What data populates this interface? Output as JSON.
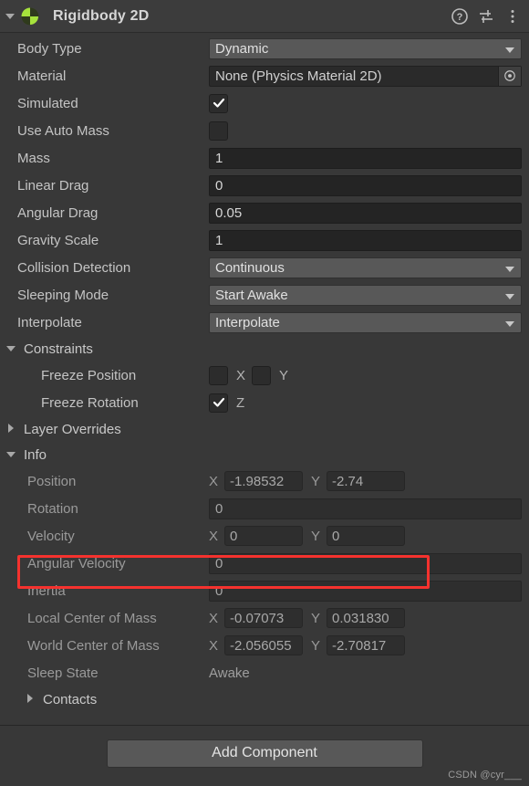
{
  "component": {
    "title": "Rigidbody 2D",
    "icon": "rigidbody2d-icon",
    "expanded": true,
    "header_icons": [
      {
        "name": "help-icon",
        "glyph": "?"
      },
      {
        "name": "preset-icon",
        "glyph": "sliders"
      },
      {
        "name": "more-menu-icon",
        "glyph": "kebab"
      }
    ]
  },
  "properties": {
    "body_type": {
      "label": "Body Type",
      "value": "Dynamic"
    },
    "material": {
      "label": "Material",
      "value": "None (Physics Material 2D)"
    },
    "simulated": {
      "label": "Simulated",
      "checked": true
    },
    "use_auto_mass": {
      "label": "Use Auto Mass",
      "checked": false
    },
    "mass": {
      "label": "Mass",
      "value": "1"
    },
    "linear_drag": {
      "label": "Linear Drag",
      "value": "0"
    },
    "angular_drag": {
      "label": "Angular Drag",
      "value": "0.05"
    },
    "gravity_scale": {
      "label": "Gravity Scale",
      "value": "1"
    },
    "collision_detection": {
      "label": "Collision Detection",
      "value": "Continuous"
    },
    "sleeping_mode": {
      "label": "Sleeping Mode",
      "value": "Start Awake"
    },
    "interpolate": {
      "label": "Interpolate",
      "value": "Interpolate"
    }
  },
  "constraints": {
    "label": "Constraints",
    "expanded": true,
    "freeze_position": {
      "label": "Freeze Position",
      "x": {
        "axis": "X",
        "checked": false
      },
      "y": {
        "axis": "Y",
        "checked": false
      }
    },
    "freeze_rotation": {
      "label": "Freeze Rotation",
      "z": {
        "axis": "Z",
        "checked": true
      }
    }
  },
  "layer_overrides": {
    "label": "Layer Overrides",
    "expanded": false
  },
  "info": {
    "label": "Info",
    "expanded": true,
    "position": {
      "label": "Position",
      "x_axis": "X",
      "x": "-1.98532",
      "y_axis": "Y",
      "y": "-2.74"
    },
    "rotation": {
      "label": "Rotation",
      "value": "0"
    },
    "velocity": {
      "label": "Velocity",
      "x_axis": "X",
      "x": "0",
      "y_axis": "Y",
      "y": "0",
      "highlighted": true
    },
    "angular_velocity": {
      "label": "Angular Velocity",
      "value": "0"
    },
    "inertia": {
      "label": "Inertia",
      "value": "0"
    },
    "local_center_of_mass": {
      "label": "Local Center of Mass",
      "x_axis": "X",
      "x": "-0.07073",
      "y_axis": "Y",
      "y": "0.031830"
    },
    "world_center_of_mass": {
      "label": "World Center of Mass",
      "x_axis": "X",
      "x": "-2.056055",
      "y_axis": "Y",
      "y": "-2.70817"
    },
    "sleep_state": {
      "label": "Sleep State",
      "value": "Awake"
    },
    "contacts": {
      "label": "Contacts",
      "expanded": false
    }
  },
  "footer": {
    "add_component_label": "Add Component",
    "watermark": "CSDN @cyr___"
  },
  "colors": {
    "panel_bg": "#383838",
    "header_bg": "#3c3c3c",
    "dropdown_bg": "#585858",
    "field_bg": "#242424",
    "highlight": "#f5322e",
    "icon_green": "#a6e23c"
  }
}
